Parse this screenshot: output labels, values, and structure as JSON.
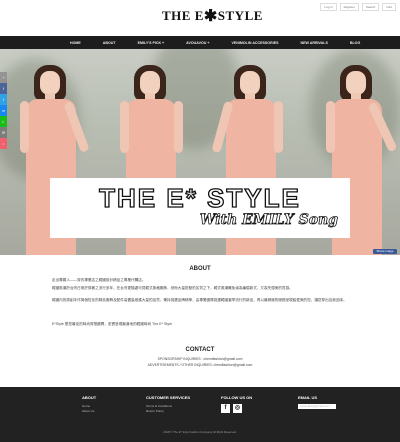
{
  "header": {
    "logo_left": "THE E",
    "logo_right": "STYLE",
    "top_links": [
      "Log in",
      "Register",
      "Search",
      "Cart"
    ]
  },
  "nav": {
    "items": [
      "HOME",
      "ABOUT",
      "EMILY'S PICK +",
      "AVOUAVOU +",
      "VENIMOLIN ACCESSORIES",
      "NEW ARRIVALS",
      "BLOG"
    ]
  },
  "share_bar": {
    "icons": [
      "plus-icon",
      "facebook-icon",
      "twitter-icon",
      "messenger-icon",
      "line-icon",
      "email-icon",
      "more-icon"
    ]
  },
  "hero": {
    "title": "THE E* STYLE",
    "subtitle": "With EMILY Song",
    "share_button": "Share image"
  },
  "about": {
    "title": "ABOUT",
    "paragraphs": [
      "走出專屬人——穿衣專業店之韓國設計精品之專業代購店。",
      "韓國風潮於台灣日常於穿著之流行多年，在台灣更隨處可見韓式風格服飾，然而大量批發的劣質之下，韓式風潮難免淪為廉價款式，又喪失優美的質感。",
      "韓國內的原創手作與個性化的精品服飾及配件皆盡量維護大量的品質，秉持挑選品牌精神，由專業團隊挑選韓國當季流行的新品，再以最精緻的服務呈現給愛美的您，讓您穿出自我品味。",
      "E*Style 是您最佳的時尚穿搭顧問，忠實呈現最道地的韓國時尚 The E* Style"
    ]
  },
  "contact": {
    "title": "CONTACT",
    "line1": "SPONSORSHIP INQUIRIES : chemifashion@gmail.com",
    "line2": "ADVERTISEMENTS / OTHER INQUIRIES: chemifashion@gmail.com"
  },
  "footer": {
    "about_title": "ABOUT",
    "about_links": [
      "Home",
      "About Us"
    ],
    "service_title": "CUSTOMER SERVICES",
    "service_links": [
      "Terms & Conditions",
      "Return Policy"
    ],
    "follow_title": "FOLLOW US ON",
    "email_title": "EMAIL US",
    "email_value": "estylelady@gmail.com",
    "copyright": "2018 © The E* Style Fashion Company All Right Reserved."
  },
  "colors": {
    "nav_bg": "#1d1d1d",
    "footer_bg": "#222222",
    "dress": "#f0b4a2",
    "share_blue": "#3b5998"
  }
}
